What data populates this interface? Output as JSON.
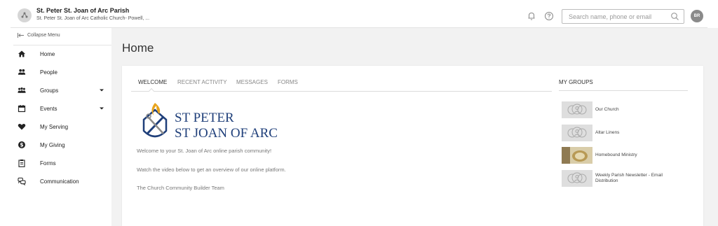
{
  "header": {
    "org_title": "St. Peter St. Joan of Arc Parish",
    "org_subtitle": "St. Peter St. Joan of Arc Catholic Church- Powell, ...",
    "search_placeholder": "Search name, phone or email",
    "avatar_initials": "BR",
    "icons": [
      "church-logo-icon",
      "bell-icon",
      "help-icon",
      "search-icon"
    ]
  },
  "sidebar": {
    "collapse_label": "Collapse Menu",
    "items": [
      {
        "label": "Home",
        "icon": "home-icon"
      },
      {
        "label": "People",
        "icon": "people-icon"
      },
      {
        "label": "Groups",
        "icon": "groups-icon",
        "has_caret": true
      },
      {
        "label": "Events",
        "icon": "calendar-icon",
        "has_caret": true
      },
      {
        "label": "My Serving",
        "icon": "heart-icon"
      },
      {
        "label": "My Giving",
        "icon": "dollar-icon"
      },
      {
        "label": "Forms",
        "icon": "clipboard-icon"
      },
      {
        "label": "Communication",
        "icon": "chat-icon"
      }
    ]
  },
  "main": {
    "page_title": "Home",
    "tabs": [
      {
        "label": "WELCOME",
        "active": true
      },
      {
        "label": "RECENT ACTIVITY",
        "active": false
      },
      {
        "label": "MESSAGES",
        "active": false
      },
      {
        "label": "FORMS",
        "active": false
      }
    ],
    "welcome": {
      "logo_line1": "ST PETER",
      "logo_line2": "ST JOAN OF ARC",
      "paragraphs": [
        "Welcome to your St. Joan of Arc online parish community!",
        "Watch the video below to get an overview of our online platform.",
        "The Church Community Builder Team"
      ]
    },
    "my_groups": {
      "title": "MY GROUPS",
      "groups": [
        {
          "name": "Our Church",
          "thumb": "placeholder"
        },
        {
          "name": "Altar Linens",
          "thumb": "placeholder"
        },
        {
          "name": "Homebound Ministry",
          "thumb": "photo"
        },
        {
          "name": "Weekly Parish Newsletter - Email Distribution",
          "thumb": "placeholder"
        }
      ]
    }
  },
  "colors": {
    "logo_blue": "#1f3f7a",
    "logo_gold": "#e8a41c",
    "main_bg": "#f2f2f2",
    "avatar_bg": "#8a8a8a"
  }
}
